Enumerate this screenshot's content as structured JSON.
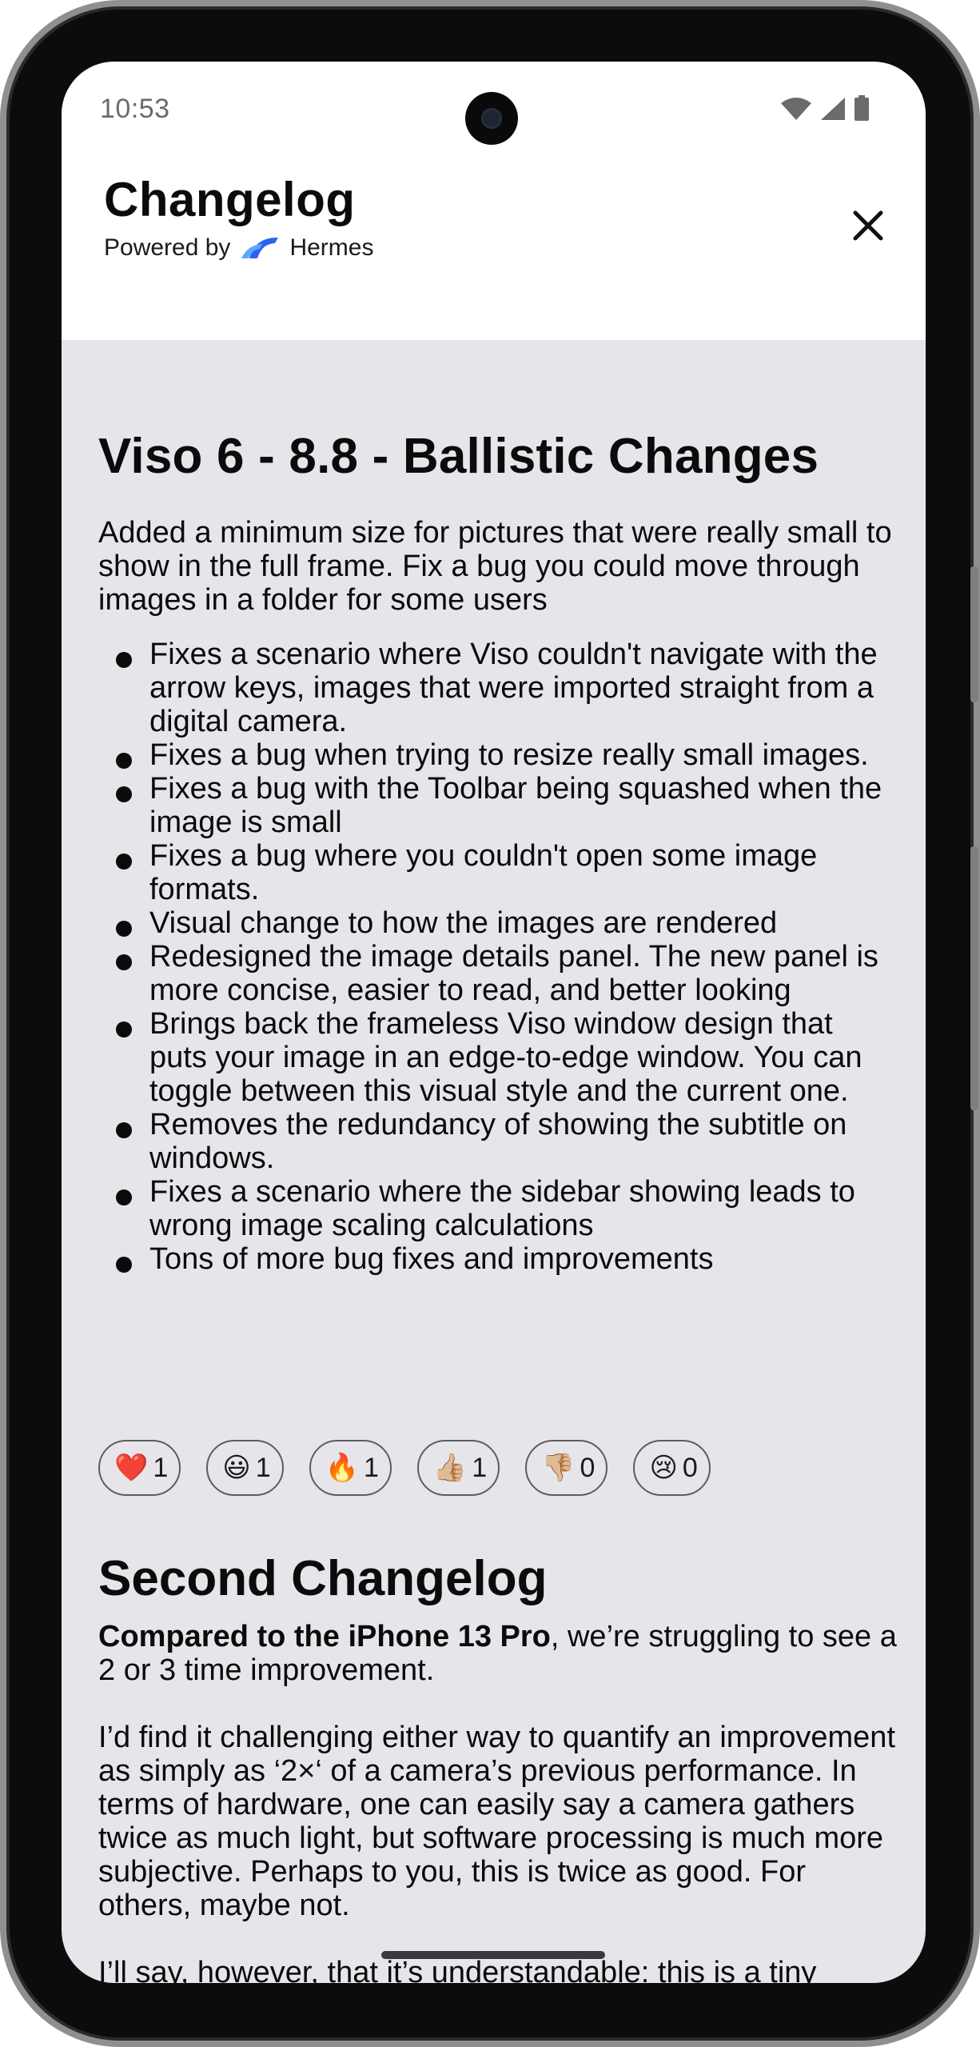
{
  "status_bar": {
    "time": "10:53",
    "icons": [
      "wifi-icon",
      "signal-icon",
      "battery-icon"
    ]
  },
  "header": {
    "title": "Changelog",
    "powered_by_prefix": "Powered by",
    "brand": "Hermes",
    "close_icon": "close-icon",
    "brand_color": "#2c62f0"
  },
  "entries": [
    {
      "title": "Viso 6 - 8.8 - Ballistic Changes",
      "intro": "Added a minimum size for pictures that were really small to show in the full frame. Fix a bug you could move through images in a folder for some users",
      "bullets": [
        "Fixes a scenario where Viso couldn't navigate with the arrow keys, images that were imported straight from a digital camera.",
        "Fixes a bug when trying to resize really small images.",
        "Fixes a bug with the Toolbar being squashed when the image is small",
        "Fixes a bug where you couldn't open some image formats.",
        "Visual change to how the images are rendered",
        "Redesigned the image details panel. The new panel is more concise, easier to read, and better looking",
        "Brings back the frameless Viso window design that puts your image in an edge-to-edge window. You can toggle between this visual style and the current one.",
        "Removes the redundancy of showing the subtitle on windows.",
        "Fixes a scenario where the sidebar showing leads to wrong image scaling calculations",
        "Tons of more bug fixes and improvements"
      ],
      "reactions": [
        {
          "emoji": "❤️",
          "count": "1",
          "name": "heart"
        },
        {
          "emoji": "😃",
          "count": "1",
          "name": "smile"
        },
        {
          "emoji": "🔥",
          "count": "1",
          "name": "fire"
        },
        {
          "emoji": "👍🏼",
          "count": "1",
          "name": "thumbs-up"
        },
        {
          "emoji": "👎🏼",
          "count": "0",
          "name": "thumbs-down"
        },
        {
          "emoji": "😢",
          "count": "0",
          "name": "sad"
        }
      ]
    },
    {
      "title": "Second Changelog",
      "p1_strong": "Compared to the iPhone 13 Pro",
      "p1_rest": ", we’re struggling to see a 2 or 3 time improvement.",
      "p2": "I’d find it challenging either way to quantify an improvement as simply as ‘2×‘ of a camera’s previous performance. In terms of hardware, one can easily say a camera gathers twice as much light, but software processing is much more subjective. Perhaps to you, this is twice as good. For others, maybe not.",
      "p3": "I’ll say, however, that it’s understandable: this is a tiny sensor, behind a tiny lens, trying its best in the dark."
    }
  ]
}
